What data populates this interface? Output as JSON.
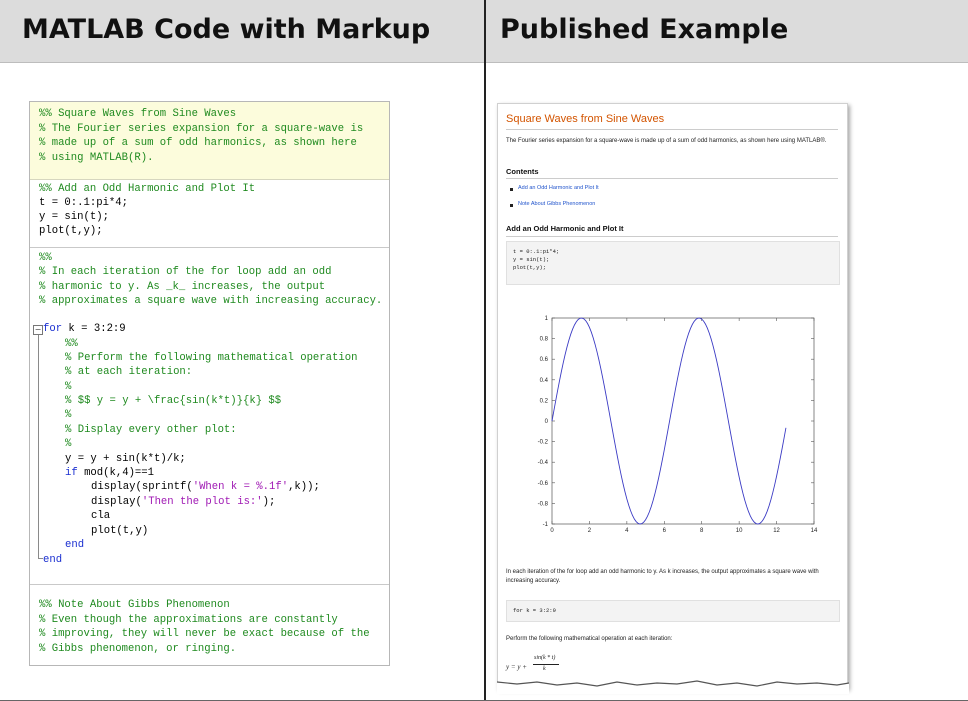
{
  "headers": {
    "left": "MATLAB Code with Markup",
    "right": "Published Example"
  },
  "editor": {
    "fold_symbol": "−",
    "lines": {
      "l1": "%% Square Waves from Sine Waves",
      "l2": "% The Fourier series expansion for a square-wave is",
      "l3": "% made up of a sum of odd harmonics, as shown here",
      "l4": "% using MATLAB(R).",
      "l5": "%% Add an Odd Harmonic and Plot It",
      "l6": "t = 0:.1:pi*4;",
      "l7": "y = sin(t);",
      "l8": "plot(t,y);",
      "l9": "%%",
      "l10": "% In each iteration of the for loop add an odd",
      "l11": "% harmonic to y. As _k_ increases, the output",
      "l12": "% approximates a square wave with increasing accuracy.",
      "l13_kw": "for",
      "l13_rest": " k = 3:2:9",
      "l14": "%%",
      "l15": "% Perform the following mathematical operation",
      "l16": "% at each iteration:",
      "l17": "%",
      "l18": "% $$ y = y + \\frac{sin(k*t)}{k} $$",
      "l19": "%",
      "l20": "% Display every other plot:",
      "l21": "%",
      "l22": "y = y + sin(k*t)/k;",
      "l23_kw": "if",
      "l23_rest": " mod(k,4)==1",
      "l24_a": "display(sprintf(",
      "l24_str": "'When k = %.1f'",
      "l24_b": ",k));",
      "l25_a": "display(",
      "l25_str": "'Then the plot is:'",
      "l25_b": ");",
      "l26": "cla",
      "l27": "plot(t,y)",
      "l28": "end",
      "l29": "end",
      "l30": "%% Note About Gibbs Phenomenon",
      "l31": "% Even though the approximations are constantly",
      "l32": "% improving, they will never be exact because of the",
      "l33": "% Gibbs phenomenon, or ringing."
    }
  },
  "published": {
    "title": "Square Waves from Sine Waves",
    "intro": "The Fourier series expansion for a square-wave is made up of a sum of odd harmonics, as shown here using MATLAB®.",
    "contents_heading": "Contents",
    "contents": [
      "Add an Odd Harmonic and Plot It",
      "Note About Gibbs Phenomenon"
    ],
    "section_heading": "Add an Odd Harmonic and Plot It",
    "code1": [
      "t = 0:.1:pi*4;",
      "y = sin(t);",
      "plot(t,y);"
    ],
    "para2": "In each iteration of the for loop add an odd harmonic to y. As k increases, the output approximates a square wave with increasing accuracy.",
    "code2": "for k = 3:2:9",
    "para3": "Perform the following mathematical operation at each iteration:",
    "equation_lhs": "y = y +",
    "equation_num": "sin(k * t)",
    "equation_den": "k",
    "plot_color": "#3b3bc4"
  },
  "chart_data": {
    "type": "line",
    "function": "sin(t)",
    "x_range": [
      0,
      12.566
    ],
    "x_step": 0.1,
    "xlim": [
      0,
      14
    ],
    "ylim": [
      -1,
      1
    ],
    "x_ticks": [
      "0",
      "2",
      "4",
      "6",
      "8",
      "10",
      "12",
      "14"
    ],
    "y_ticks": [
      "1",
      "0.8",
      "0.6",
      "0.4",
      "0.2",
      "0",
      "-0.2",
      "-0.4",
      "-0.6",
      "-0.8",
      "-1"
    ],
    "grid": false
  }
}
